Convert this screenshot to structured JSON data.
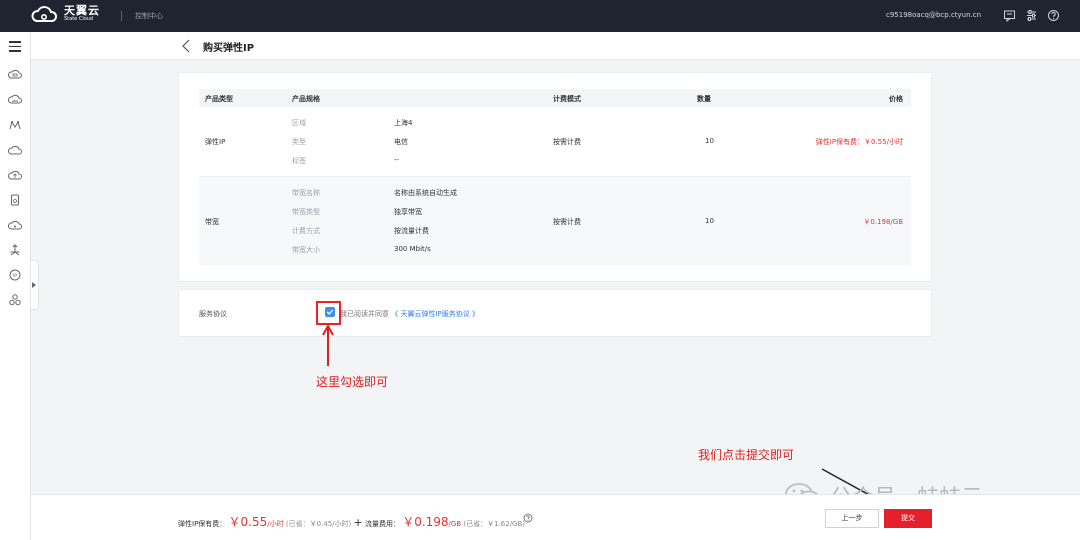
{
  "topbar": {
    "logo_cn": "天翼云",
    "logo_en": "State Cloud",
    "console_link": "控制中心",
    "user_email": "c95198oacq@bcp.ctyun.cn",
    "icons": [
      "message-icon",
      "settings-sliders-icon",
      "help-circle-icon"
    ],
    "bg_color": "#1f2430"
  },
  "sidebar": {
    "icons": [
      "menu-icon",
      "cloud-host-icon",
      "cloud-disk-icon",
      "network-icon",
      "cloud-icon",
      "cloud-upload-icon",
      "storage-icon",
      "cloud-outline-icon",
      "load-balance-icon",
      "eip-icon",
      "cluster-icon"
    ]
  },
  "page": {
    "title": "购买弹性IP"
  },
  "table": {
    "headers": {
      "type": "产品类型",
      "spec": "产品规格",
      "billing": "计费模式",
      "quantity": "数量",
      "price": "价格"
    },
    "rows": [
      {
        "type": "弹性IP",
        "specs": [
          {
            "k": "区域",
            "v": "上海4"
          },
          {
            "k": "类型",
            "v": "电信"
          },
          {
            "k": "标签",
            "v": "--"
          }
        ],
        "billing": "按需计费",
        "quantity": "10",
        "price": "弹性IP保有费：￥0.55/小时"
      },
      {
        "type": "带宽",
        "specs": [
          {
            "k": "带宽名称",
            "v": "名称由系统自动生成"
          },
          {
            "k": "带宽类型",
            "v": "独享带宽"
          },
          {
            "k": "计费方式",
            "v": "按流量计费"
          },
          {
            "k": "带宽大小",
            "v": "300 Mbit/s"
          }
        ],
        "billing": "按需计费",
        "quantity": "10",
        "price": "￥0.198/GB"
      }
    ]
  },
  "agreement": {
    "label": "服务协议",
    "checked": true,
    "text_prefix": "我已阅读并同意",
    "link": "《 天翼云弹性IP服务协议 》"
  },
  "annotations": {
    "check_hint": "这里勾选即可",
    "submit_hint": "我们点击提交即可",
    "color": "#e02020"
  },
  "footer": {
    "ip_fee_label": "弹性IP保有费：",
    "ip_fee_amount": "￥0.55",
    "ip_fee_unit": "/小时",
    "ip_fee_note": "(已省：￥0.45/小时)",
    "plus": "+",
    "traffic_label": "流量费用：",
    "traffic_amount": "￥0.198",
    "traffic_unit": "/GB",
    "traffic_note": "(已省：￥1.62/GB)",
    "prev_button": "上一步",
    "submit_button": "提交"
  },
  "watermark": {
    "text": "公众号 · 蛙蛙云"
  }
}
